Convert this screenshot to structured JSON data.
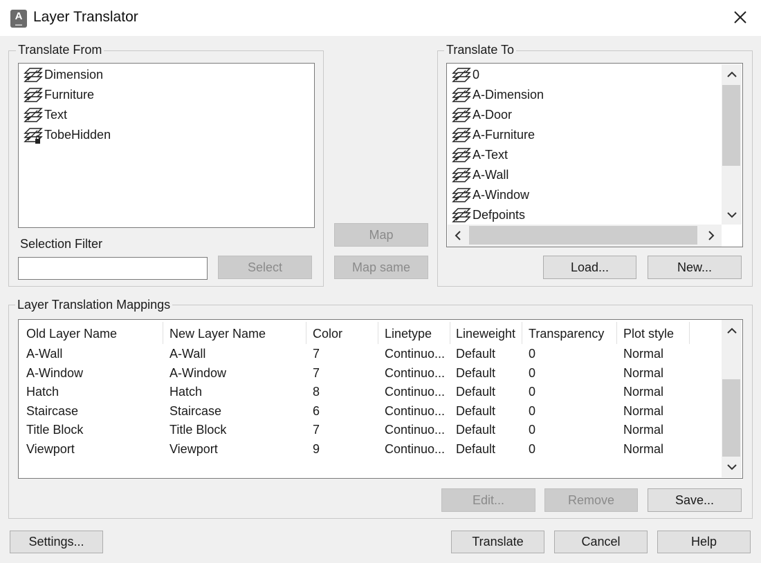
{
  "window": {
    "title": "Layer Translator"
  },
  "translate_from": {
    "label": "Translate From",
    "layers": [
      {
        "name": "Dimension",
        "locked": false
      },
      {
        "name": "Furniture",
        "locked": false
      },
      {
        "name": "Text",
        "locked": false
      },
      {
        "name": "TobeHidden",
        "locked": true
      }
    ],
    "selection_filter_label": "Selection Filter",
    "selection_filter_value": "",
    "select_button": "Select"
  },
  "center": {
    "map_button": "Map",
    "map_same_button": "Map same"
  },
  "translate_to": {
    "label": "Translate To",
    "layers": [
      "0",
      "A-Dimension",
      "A-Door",
      "A-Furniture",
      "A-Text",
      "A-Wall",
      "A-Window",
      "Defpoints"
    ],
    "load_button": "Load...",
    "new_button": "New..."
  },
  "mappings": {
    "label": "Layer Translation Mappings",
    "columns": [
      "Old Layer Name",
      "New Layer Name",
      "Color",
      "Linetype",
      "Lineweight",
      "Transparency",
      "Plot style"
    ],
    "rows": [
      [
        "A-Wall",
        "A-Wall",
        "7",
        "Continuo...",
        "Default",
        "0",
        "Normal"
      ],
      [
        "A-Window",
        "A-Window",
        "7",
        "Continuo...",
        "Default",
        "0",
        "Normal"
      ],
      [
        "Hatch",
        "Hatch",
        "8",
        "Continuo...",
        "Default",
        "0",
        "Normal"
      ],
      [
        "Staircase",
        "Staircase",
        "6",
        "Continuo...",
        "Default",
        "0",
        "Normal"
      ],
      [
        "Title Block",
        "Title Block",
        "7",
        "Continuo...",
        "Default",
        "0",
        "Normal"
      ],
      [
        "Viewport",
        "Viewport",
        "9",
        "Continuo...",
        "Default",
        "0",
        "Normal"
      ]
    ],
    "edit_button": "Edit...",
    "remove_button": "Remove",
    "save_button": "Save..."
  },
  "footer": {
    "settings_button": "Settings...",
    "translate_button": "Translate",
    "cancel_button": "Cancel",
    "help_button": "Help"
  }
}
